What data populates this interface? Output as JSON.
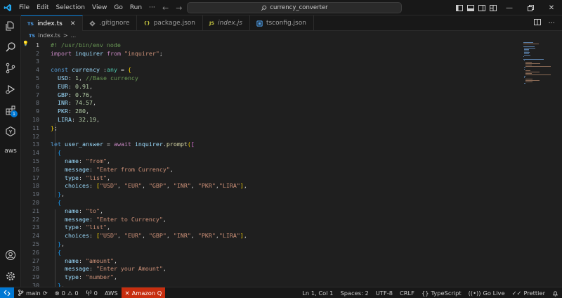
{
  "titlebar": {
    "menu": [
      "File",
      "Edit",
      "Selection",
      "View",
      "Go",
      "Run",
      "···"
    ],
    "search_text": "currency_converter"
  },
  "tabs": [
    {
      "label": "index.ts",
      "icon": "TS",
      "active": true
    },
    {
      "label": ".gitignore",
      "icon": "git-icon",
      "active": false
    },
    {
      "label": "package.json",
      "icon": "{}",
      "active": false
    },
    {
      "label": "index.js",
      "icon": "JS",
      "active": false
    },
    {
      "label": "tsconfig.json",
      "icon": "tsconfig-icon",
      "active": false
    }
  ],
  "breadcrumb": {
    "file_icon": "TS",
    "file": "index.ts",
    "sep": ">",
    "rest": "..."
  },
  "activity": {
    "extensions_badge": "1",
    "aws_label": "aws"
  },
  "editor": {
    "lines": [
      {
        "n": "1",
        "t": "#! /usr/bin/env node"
      },
      {
        "n": "2",
        "t": "import inquirer from \"inquirer\";"
      },
      {
        "n": "3",
        "t": ""
      },
      {
        "n": "4",
        "t": "const currency :any = {"
      },
      {
        "n": "5",
        "t": "  USD: 1, //Base currency"
      },
      {
        "n": "6",
        "t": "  EUR: 0.91,"
      },
      {
        "n": "7",
        "t": "  GBP: 0.76,"
      },
      {
        "n": "8",
        "t": "  INR: 74.57,"
      },
      {
        "n": "9",
        "t": "  PKR: 280,"
      },
      {
        "n": "10",
        "t": "  LIRA: 32.19,"
      },
      {
        "n": "11",
        "t": "};"
      },
      {
        "n": "12",
        "t": ""
      },
      {
        "n": "13",
        "t": "let user_answer = await inquirer.prompt(["
      },
      {
        "n": "14",
        "t": "  {"
      },
      {
        "n": "15",
        "t": "    name: \"from\","
      },
      {
        "n": "16",
        "t": "    message: \"Enter from Currency\","
      },
      {
        "n": "17",
        "t": "    type: \"list\","
      },
      {
        "n": "18",
        "t": "    choices: [\"USD\", \"EUR\", \"GBP\", \"INR\", \"PKR\",\"LIRA\"],"
      },
      {
        "n": "19",
        "t": "  },"
      },
      {
        "n": "20",
        "t": "  {"
      },
      {
        "n": "21",
        "t": "    name: \"to\","
      },
      {
        "n": "22",
        "t": "    message: \"Enter to Currency\","
      },
      {
        "n": "23",
        "t": "    type: \"list\","
      },
      {
        "n": "24",
        "t": "    choices: [\"USD\", \"EUR\", \"GBP\", \"INR\", \"PKR\",\"LIRA\"],"
      },
      {
        "n": "25",
        "t": "  },"
      },
      {
        "n": "26",
        "t": "  {"
      },
      {
        "n": "27",
        "t": "    name: \"amount\","
      },
      {
        "n": "28",
        "t": "    message: \"Enter your Amount\","
      },
      {
        "n": "29",
        "t": "    type: \"number\","
      },
      {
        "n": "30",
        "t": "  },"
      }
    ]
  },
  "statusbar": {
    "branch": "main",
    "errors": "0",
    "warnings": "0",
    "ports": "0",
    "aws": "AWS",
    "amazon_q": "Amazon Q",
    "position": "Ln 1, Col 1",
    "spaces": "Spaces: 2",
    "encoding": "UTF-8",
    "eol": "CRLF",
    "language": "TypeScript",
    "go_live": "Go Live",
    "prettier": "Prettier"
  },
  "colors": {
    "accent": "#0078d4",
    "amazon_q": "#c72e0f",
    "editor_bg": "#1f1f1f",
    "chrome_bg": "#181818"
  }
}
